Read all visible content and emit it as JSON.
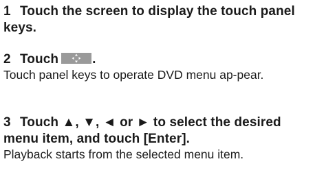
{
  "steps": [
    {
      "number": "1",
      "heading": "Touch the screen to display the touch panel keys."
    },
    {
      "number": "2",
      "heading_prefix": "Touch",
      "heading_suffix": ".",
      "icon": "directional-pad-icon",
      "body": "Touch panel keys to operate DVD menu ap-pear."
    },
    {
      "number": "3",
      "heading": "Touch ▲, ▼, ◄ or ► to select the desired menu item, and touch [Enter].",
      "body": "Playback starts from the selected menu item."
    }
  ],
  "colors": {
    "text": "#1a1a1a",
    "key_background": "#9a9a9a",
    "key_arrows": "#ffffff"
  }
}
